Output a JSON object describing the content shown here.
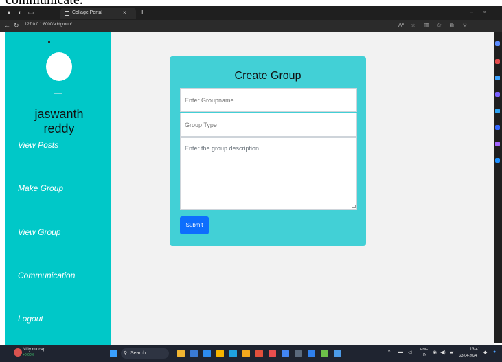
{
  "top_crop_text": "communicate.",
  "browser": {
    "tab_title": "Collage Portal",
    "url": "127.0.0.1:8000/addgroup/",
    "new_tab_glyph": "+",
    "close_glyph": "×"
  },
  "sidebar": {
    "username": "jaswanth reddy",
    "links": [
      {
        "label": "View Posts"
      },
      {
        "label": "Make Group"
      },
      {
        "label": "View Group"
      },
      {
        "label": "Communication"
      },
      {
        "label": "Logout"
      }
    ]
  },
  "form": {
    "title": "Create Group",
    "groupname_placeholder": "Enter Groupname",
    "grouptype_placeholder": "Group Type",
    "description_placeholder": "Enter the group description",
    "submit_label": "Submit"
  },
  "taskbar": {
    "weather_title": "Nifty midcap",
    "weather_sub": "+0.00%",
    "search_label": "Search",
    "lang_top": "ENG",
    "lang_bottom": "IN",
    "time": "13:41",
    "date": "23-04-2024"
  },
  "colors": {
    "sidebar": "#00c8c8",
    "card": "#42d0d6",
    "submit": "#0d6efd",
    "main_bg": "#f2f2f2"
  },
  "icons": [
    "profile-icon",
    "tab-favicon",
    "back-icon",
    "refresh-icon",
    "windows-start-icon",
    "search-icon"
  ]
}
